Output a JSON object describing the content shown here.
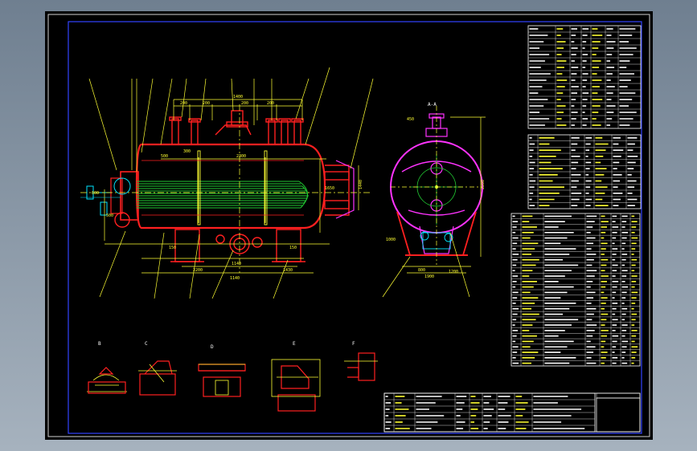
{
  "colors": {
    "background": "#8a97a6",
    "sheet": "#000000",
    "frame": "#ffffff",
    "border": "#2b39ff",
    "shell": "#ff1e1e",
    "dims": "#ffff33",
    "tubes": "#2fd02f",
    "cyan": "#00e5ff",
    "magenta": "#ff33ff",
    "table": "#ffffff"
  },
  "dimension_labels": [
    "1400",
    "200",
    "200",
    "200",
    "200",
    "300",
    "500",
    "2300",
    "1140",
    "1140",
    "2200",
    "1430",
    "600",
    "500",
    "1650",
    "1440",
    "2200",
    "800",
    "1900",
    "1200",
    "1000",
    "450",
    "150",
    "150"
  ],
  "section_labels": [
    "A-A",
    "B",
    "C",
    "D",
    "E",
    "F"
  ],
  "title_block": {
    "lines": [
      "",
      "",
      ""
    ]
  }
}
